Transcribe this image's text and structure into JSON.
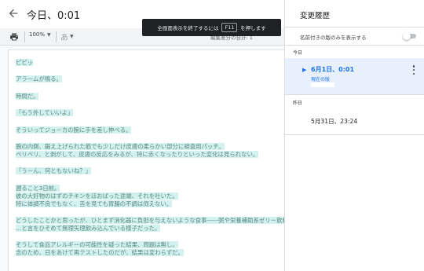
{
  "header": {
    "title": "今日、0:01"
  },
  "toolbar": {
    "zoom": "100%",
    "style_placeholder": "あ",
    "right_hint": "編集差分の合計: 1"
  },
  "toast": {
    "text_before": "全画面表示を終了するには",
    "key": "F11",
    "text_after": "を押します"
  },
  "document": {
    "lines": [
      "ピピッ",
      "アラームが鳴る。",
      "時間だ。",
      "「もう外していいよ」",
      "そういってジョーカの腕に手を差し伸べる。",
      "腕の内側、鍛え上げられた筋でも少しだけ皮膚の柔らかい部分に検査用パッチ。",
      "ペリペリ、と剥がして、皮膚の反応をみるが、特に赤くなったりといった変化は見られない。",
      "「うーん、何ともないね？」",
      "遡ること3日前。",
      "彼の大好物のはずのチキンをほおばった途端、それを吐いた。",
      "特に体調不良でもなく、舌を見ても胃腸の不調は伺えない。",
      "どうしたことかと思ったが、ひとまず消化器に負担を与えないような食事――粥や栄養補助系ゼリー飲料の摂取を",
      "…と言をひそめて無理矢理飲み込んでいる様子だった。",
      "そうして食品アレルギーの可能性を疑った結果、問題は無し。",
      "念のため、日をあけて再テストしたのだが、結果は変わらずだ。"
    ]
  },
  "history": {
    "title": "変更履歴",
    "named_only_label": "名前付きの版のみを表示する",
    "named_only_enabled": false,
    "sections": [
      {
        "label": "今日",
        "versions": [
          {
            "date": "6月1日、0:01",
            "current_label": "現在の版",
            "selected": true
          }
        ]
      },
      {
        "label": "昨日",
        "versions": [
          {
            "date": "5月31日、23:24",
            "selected": false
          }
        ]
      }
    ]
  },
  "colors": {
    "accent": "#1a73e8",
    "selected_bg": "#e8f0fe",
    "highlight_bg": "#d3f1ee",
    "highlight_text": "#5b8a86",
    "toast_bg": "#202124"
  }
}
